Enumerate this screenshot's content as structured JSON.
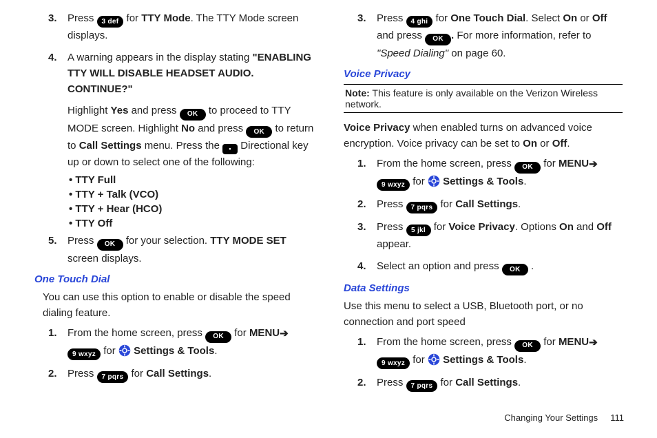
{
  "keys": {
    "ok": "OK",
    "k3": "3 def",
    "k4": "4 ghi",
    "k5": "5 jkl",
    "k7": "7 pqrs",
    "k9": "9 wxyz",
    "dir": "•"
  },
  "left": {
    "s3a": "Press ",
    "s3b": " for ",
    "s3bold": "TTY Mode",
    "s3c": ". The TTY Mode screen displays.",
    "s4a": "A warning appears in the display stating ",
    "s4bold": "\"ENABLING TTY WILL DISABLE HEADSET AUDIO. CONTINUE?\"",
    "s4para_a": "Highlight ",
    "s4para_yes": "Yes",
    "s4para_b": " and press ",
    "s4para_c": " to proceed to TTY MODE screen. Highlight ",
    "s4para_no": "No",
    "s4para_d": " and press ",
    "s4para_e": " to return to ",
    "s4para_cs": "Call Settings",
    "s4para_f": " menu. Press the ",
    "s4para_g": " Directional key up or down to select one of the following:",
    "b1": "• TTY Full",
    "b2": "• TTY + Talk (VCO)",
    "b3": "• TTY + Hear (HCO)",
    "b4": "• TTY Off",
    "s5a": "Press ",
    "s5b": " for your selection. ",
    "s5bold": "TTY MODE SET",
    "s5c": " screen displays.",
    "h1": "One Touch Dial",
    "h1para": "You can use this option to enable or disable the speed dialing feature.",
    "l1a": "From the home screen, press ",
    "l1b": " for ",
    "l1menu": "MENU",
    "l1arrow": " ➔ ",
    "l1c": " for ",
    "l1st": "Settings & Tools",
    "l1d": ".",
    "l2a": "Press ",
    "l2b": " for ",
    "l2cs": "Call Settings",
    "l2c": "."
  },
  "right": {
    "r3a": "Press ",
    "r3b": " for ",
    "r3bold": "One Touch Dial",
    "r3c": ". Select ",
    "r3on": "On",
    "r3d": " or ",
    "r3off": "Off",
    "r3e": " and press ",
    "r3f": " For more information, refer to ",
    "r3ref": "\"Speed Dialing\"",
    "r3g": "  on page 60.",
    "h2": "Voice Privacy",
    "note_label": "Note:",
    "note": " This feature is only available on the Verizon Wireless network.",
    "vp1a": "Voice Privacy",
    "vp1b": " when enabled turns on advanced voice encryption. Voice privacy can be set to ",
    "vp1on": "On",
    "vp1c": " or ",
    "vp1off": "Off",
    "vp1d": ".",
    "v1a": "From the home screen, press ",
    "v1b": " for ",
    "v1menu": "MENU",
    "v1arrow": " ➔ ",
    "v1c": " for ",
    "v1st": "Settings & Tools",
    "v1d": ".",
    "v2a": "Press ",
    "v2b": " for ",
    "v2cs": "Call Settings",
    "v2c": ".",
    "v3a": "Press ",
    "v3b": " for ",
    "v3vp": "Voice Privacy",
    "v3c": ". Options ",
    "v3on": "On",
    "v3d": " and ",
    "v3off": "Off",
    "v3e": " appear.",
    "v4a": "Select an option and press ",
    "v4b": ".",
    "h3": "Data Settings",
    "dspara": "Use this menu to select a USB, Bluetooth port, or no connection and port speed",
    "d1a": "From the home screen, press ",
    "d1b": " for ",
    "d1menu": "MENU",
    "d1arrow": " ➔ ",
    "d1c": " for ",
    "d1st": "Settings & Tools",
    "d1d": ".",
    "d2a": "Press ",
    "d2b": " for ",
    "d2cs": "Call Settings",
    "d2c": "."
  },
  "footer_text": "Changing Your Settings",
  "footer_page": "111"
}
